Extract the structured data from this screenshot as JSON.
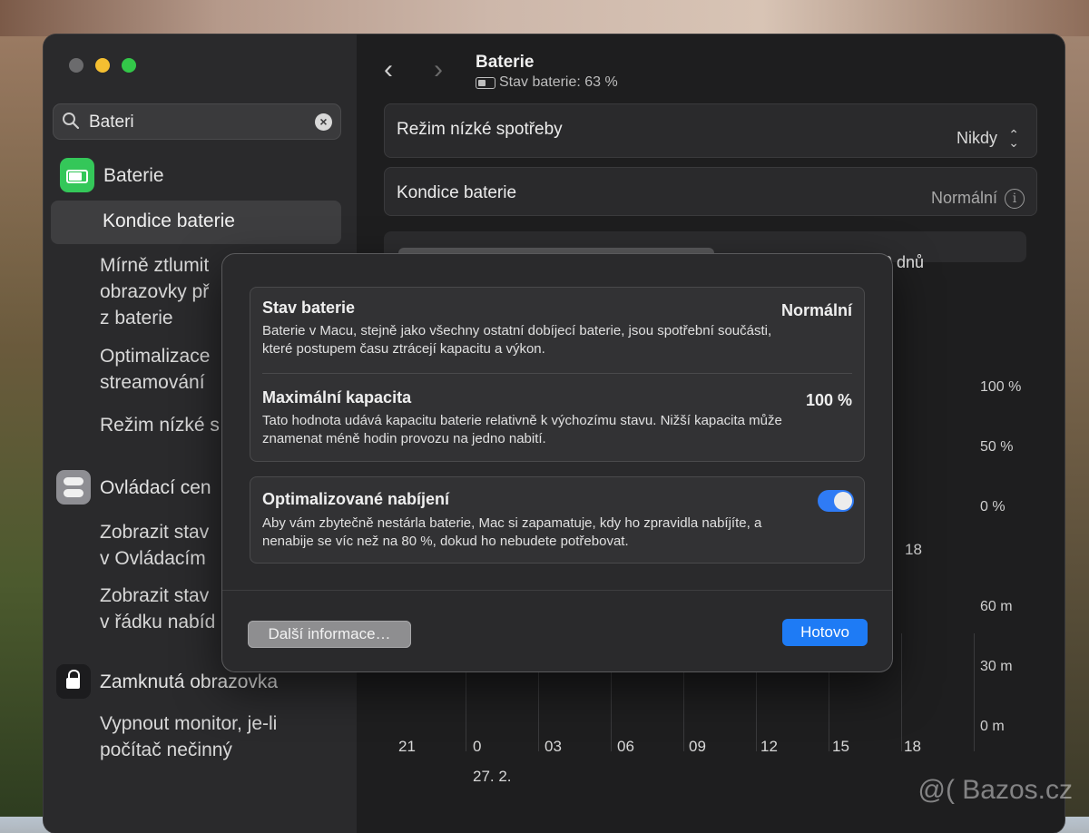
{
  "window": {
    "traffic": [
      "close",
      "minimize",
      "zoom"
    ]
  },
  "sidebar": {
    "search": {
      "value": "Bateri",
      "placeholder": ""
    },
    "sections": [
      {
        "title": "Baterie",
        "icon": "battery-icon",
        "icon_color": "#34c759"
      },
      {
        "title": "Ovládací cen",
        "icon": "control-center-icon",
        "icon_color": "#8e8e93"
      },
      {
        "title": "Zamknutá obrazovka",
        "icon": "lock-icon",
        "icon_color": "#1c1c1e"
      }
    ],
    "subitems": {
      "active": "Kondice baterie",
      "s1": "Mírně ztlumit\nobrazovky př\nz baterie",
      "s2": "Optimalizace\nstreamování",
      "s3": "Režim nízké s",
      "s4": "Zobrazit stav\nv Ovládacím",
      "s5": "Zobrazit stav\nv řádku nabíd",
      "s6": "Vypnout monitor, je-li\npočítač nečinný"
    }
  },
  "main": {
    "title": "Baterie",
    "subtitle": "Stav baterie: 63 %",
    "low_power": {
      "label": "Režim nízké spotřeby",
      "value": "Nikdy"
    },
    "health": {
      "label": "Kondice baterie",
      "value": "Normální"
    },
    "segment": {
      "b": "10 dnů"
    },
    "y_axis_top": [
      "100 %",
      "50 %",
      "0 %"
    ],
    "y_axis_bottom": [
      "60 m",
      "30 m",
      "0 m"
    ],
    "x_ticks": [
      "21",
      "0",
      "03",
      "06",
      "09",
      "12",
      "15",
      "18"
    ],
    "x_tick_mid": "18",
    "date_label": "27. 2."
  },
  "modal": {
    "stav": {
      "title": "Stav baterie",
      "value": "Normální",
      "desc": "Baterie v Macu, stejně jako všechny ostatní dobíjecí baterie, jsou spotřební součásti, které postupem času ztrácejí kapacitu a výkon."
    },
    "kapacita": {
      "title": "Maximální kapacita",
      "value": "100 %",
      "desc": "Tato hodnota udává kapacitu baterie relativně k výchozímu stavu. Nižší kapacita může znamenat méně hodin provozu na jedno nabití."
    },
    "optimal": {
      "title": "Optimalizované nabíjení",
      "enabled": true,
      "desc": "Aby vám zbytečně nestárla baterie, Mac si zapamatuje, kdy ho zpravidla nabíjíte, a nenabije se víc než na 80 %, dokud ho nebudete potřebovat."
    },
    "more_button": "Další informace…",
    "done_button": "Hotovo"
  },
  "watermark": "@( Bazos.cz"
}
